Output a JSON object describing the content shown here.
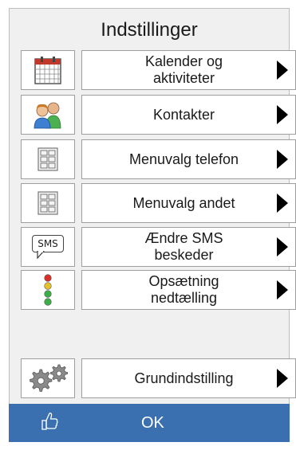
{
  "window": {
    "title": "Indstillinger"
  },
  "menu": {
    "items": [
      {
        "label": "Kalender og\naktiviteter",
        "icon": "calendar-icon"
      },
      {
        "label": "Kontakter",
        "icon": "contacts-icon"
      },
      {
        "label": "Menuvalg telefon",
        "icon": "grid-icon"
      },
      {
        "label": "Menuvalg andet",
        "icon": "grid-icon"
      },
      {
        "label": "Ændre SMS\nbeskeder",
        "icon": "sms-icon"
      },
      {
        "label": "Opsætning\nnedtælling",
        "icon": "countdown-lights-icon"
      }
    ],
    "sms_icon_text": "SMS",
    "basic": {
      "label": "Grundindstilling",
      "icon": "gears-icon"
    }
  },
  "footer": {
    "ok_label": "OK",
    "ok_icon": "thumbs-up-icon"
  },
  "colors": {
    "ok_bar": "#3a6fb0",
    "background": "#f0f0f0",
    "calendar_red": "#c0392b"
  }
}
